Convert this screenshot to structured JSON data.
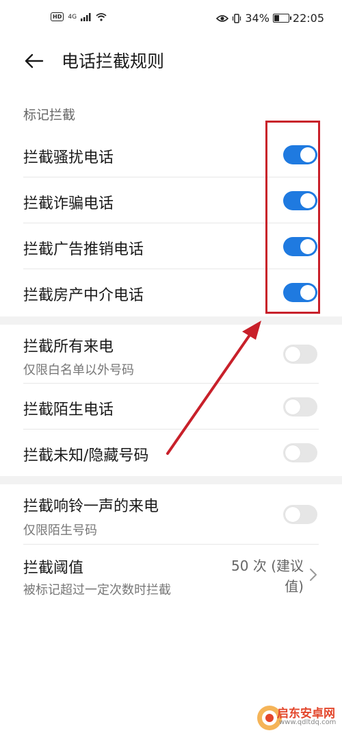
{
  "status_bar": {
    "hd": "HD",
    "network": "4G",
    "battery": "34%",
    "battery_level": 0.34,
    "time": "22:05"
  },
  "header": {
    "title": "电话拦截规则"
  },
  "section_marked": {
    "label": "标记拦截",
    "items": [
      {
        "label": "拦截骚扰电话",
        "on": true
      },
      {
        "label": "拦截诈骗电话",
        "on": true
      },
      {
        "label": "拦截广告推销电话",
        "on": true
      },
      {
        "label": "拦截房产中介电话",
        "on": true
      }
    ]
  },
  "section_all": {
    "all_calls": {
      "label": "拦截所有来电",
      "sub": "仅限白名单以外号码",
      "on": false
    },
    "strangers": {
      "label": "拦截陌生电话",
      "on": false
    },
    "unknown": {
      "label": "拦截未知/隐藏号码",
      "on": false
    }
  },
  "section_ring": {
    "ring_once": {
      "label": "拦截响铃一声的来电",
      "sub": "仅限陌生号码",
      "on": false
    },
    "threshold": {
      "label": "拦截阈值",
      "sub": "被标记超过一定次数时拦截",
      "value_line1": "50 次 (建议",
      "value_line2": "值)"
    }
  },
  "watermark": {
    "brand": "启东安卓网",
    "url": "www.qdltdq.com"
  },
  "colors": {
    "switch_on": "#1f7ae0",
    "switch_off": "#e6e6e6",
    "annotation": "#c8202a"
  }
}
